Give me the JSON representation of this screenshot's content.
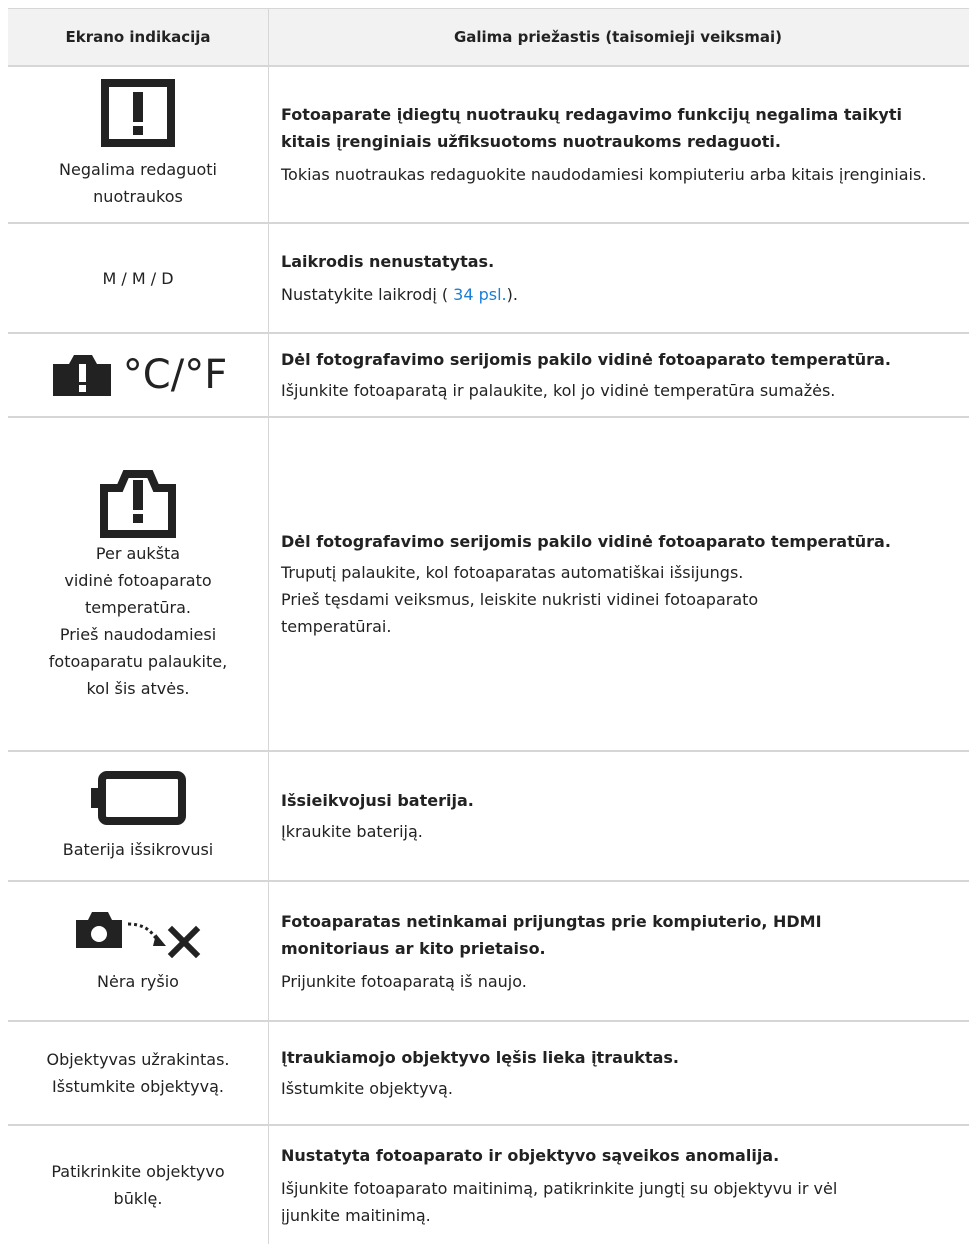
{
  "header": {
    "col1": "Ekrano indikacija",
    "col2": "Galima priežastis (taisomieji veiksmai)"
  },
  "rows": [
    {
      "indication": "Negalima redaguoti nuotraukos",
      "icon": "warning-box-icon",
      "cause": "Fotoaparate įdiegtų nuotraukų redagavimo funkcijų negalima taikyti kitais įrenginiais užfiksuotoms nuotraukoms redaguoti.",
      "action": "Tokias nuotraukas redaguokite naudodamiesi kompiuteriu arba kitais įrenginiais."
    },
    {
      "indication": "M / M / D",
      "cause": "Laikrodis nenustatytas.",
      "action_prefix": "Nustatykite laikrodį ( ",
      "action_link": "34 psl.",
      "action_suffix": ")."
    },
    {
      "indication_icon_text": "°C/°F",
      "icon": "camera-temperature-icon",
      "cause": "Dėl fotografavimo serijomis pakilo vidinė fotoaparato temperatūra.",
      "action": "Išjunkite fotoaparatą ir palaukite, kol jo vidinė temperatūra sumažės."
    },
    {
      "indication_lines": [
        "Per aukšta",
        "vidinė fotoaparato",
        "temperatūra.",
        "Prieš naudodamiesi",
        "fotoaparatu palaukite,",
        "kol šis atvės."
      ],
      "icon": "camera-warning-outline-icon",
      "cause": "Dėl fotografavimo serijomis pakilo vidinė fotoaparato temperatūra.",
      "action_lines": [
        "Truputį palaukite, kol fotoaparatas automatiškai išsijungs.",
        "Prieš tęsdami veiksmus, leiskite nukristi vidinei fotoaparato",
        "temperatūrai."
      ]
    },
    {
      "indication": "Baterija išsikrovusi",
      "icon": "battery-empty-icon",
      "cause": "Išsieikvojusi baterija.",
      "action": "Įkraukite bateriją."
    },
    {
      "indication": "Nėra ryšio",
      "icon": "no-connection-icon",
      "cause_lines": [
        "Fotoaparatas netinkamai prijungtas prie kompiuterio, HDMI",
        "monitoriaus ar kito prietaiso."
      ],
      "action": "Prijunkite fotoaparatą iš naujo."
    },
    {
      "indication_lines": [
        "Objektyvas užrakintas.",
        "Išstumkite objektyvą."
      ],
      "cause": "Įtraukiamojo objektyvo lęšis lieka įtrauktas.",
      "action": "Išstumkite objektyvą."
    },
    {
      "indication_lines": [
        "Patikrinkite objektyvo",
        "būklę."
      ],
      "cause": "Nustatyta fotoaparato ir objektyvo sąveikos anomalija.",
      "action_lines": [
        "Išjunkite fotoaparato maitinimą, patikrinkite jungtį su objektyvu ir vėl",
        "įjunkite maitinimą."
      ]
    }
  ],
  "colors": {
    "link": "#1a7ed6",
    "header_bg": "#f2f2f2",
    "border": "#d6d6d6"
  }
}
